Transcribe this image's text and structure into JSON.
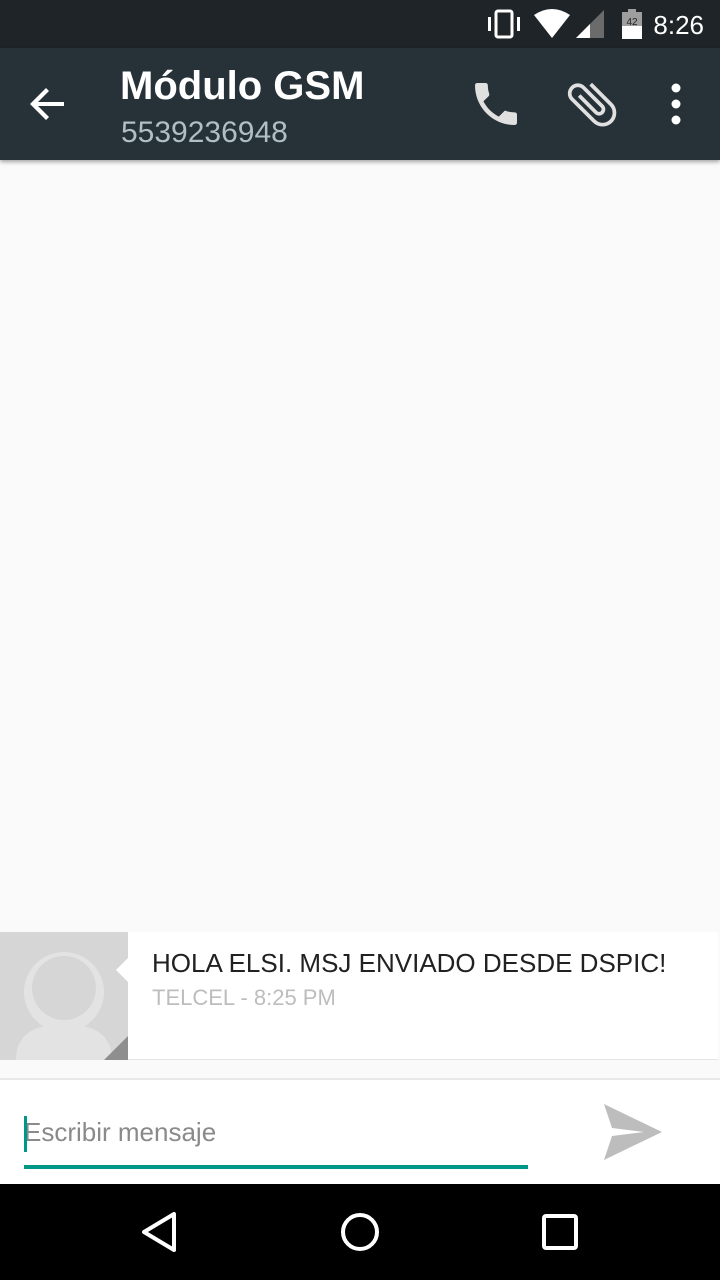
{
  "status_bar": {
    "time": "8:26",
    "icons": [
      "vibrate-icon",
      "wifi-icon",
      "signal-icon",
      "battery-icon"
    ],
    "battery_level_text": "42"
  },
  "app_bar": {
    "title": "Módulo GSM",
    "subtitle": "5539236948",
    "background_color": "#263238",
    "actions": [
      "back-arrow-icon",
      "phone-icon",
      "paperclip-icon",
      "overflow-menu-icon"
    ]
  },
  "conversation": {
    "messages": [
      {
        "direction": "incoming",
        "text": "HOLA ELSI.  MSJ ENVIADO DESDE DSPIC!",
        "meta": "TELCEL - 8:25 PM"
      }
    ]
  },
  "compose": {
    "placeholder": "Escribir mensaje",
    "value": "",
    "accent_color": "#009688"
  },
  "nav_bar": {
    "buttons": [
      "back-triangle-icon",
      "home-circle-icon",
      "recents-square-icon"
    ]
  }
}
